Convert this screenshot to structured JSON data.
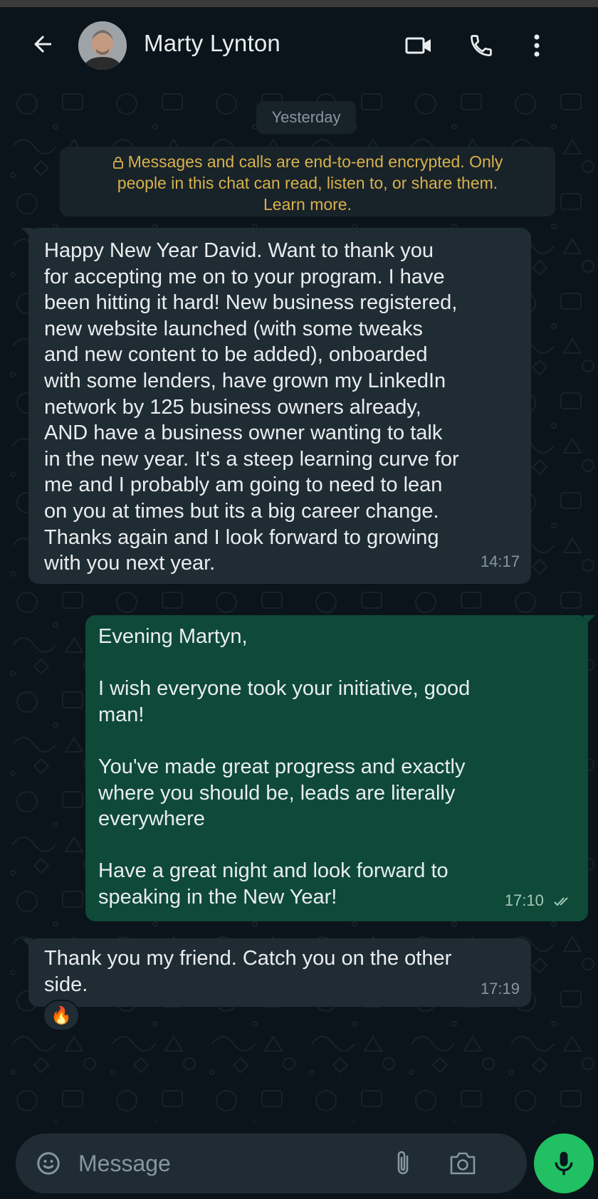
{
  "header": {
    "contact_name": "Marty Lynton"
  },
  "chat": {
    "date_chip": "Yesterday",
    "encryption_notice": {
      "line1": "Messages and calls are end-to-end encrypted. Only",
      "line2": "people in this chat can read, listen to, or share them.",
      "line3": "Learn more."
    },
    "messages": [
      {
        "direction": "incoming",
        "text": "Happy New Year David. Want to thank you\nfor accepting me on to your program. I have\nbeen hitting it hard! New business registered,\nnew website launched (with some tweaks\nand new content to be added), onboarded\nwith some lenders, have grown my LinkedIn\nnetwork by 125 business owners already,\nAND have a business owner wanting to talk\nin the new year. It's a steep learning curve for\nme and I probably am going to need to lean\non you at times but its a big career change.\nThanks again and I look forward to growing\nwith you next year.",
        "time": "14:17"
      },
      {
        "direction": "outgoing",
        "text": "Evening Martyn,\n\nI wish everyone took your initiative, good\nman!\n\nYou've made great progress and exactly\nwhere you should be, leads are literally\neverywhere\n\nHave a great night and look forward to\nspeaking in the New Year!",
        "time": "17:10",
        "status": "read"
      },
      {
        "direction": "incoming",
        "text": "Thank you my friend. Catch you on the other\nside.",
        "time": "17:19",
        "reaction": "🔥"
      }
    ]
  },
  "composer": {
    "placeholder": "Message"
  },
  "colors": {
    "background": "#0b141a",
    "incoming_bubble": "#202c33",
    "outgoing_bubble": "#0e4a37",
    "mic_button": "#21c063",
    "encryption_text": "#d8b24a"
  },
  "icons": {
    "back": "arrow-left-icon",
    "video": "video-call-icon",
    "phone": "phone-icon",
    "menu": "more-vertical-icon",
    "lock": "lock-icon",
    "emoji": "emoji-sticker-icon",
    "attach": "paperclip-icon",
    "camera": "camera-icon",
    "mic": "microphone-icon",
    "read": "double-check-icon"
  }
}
